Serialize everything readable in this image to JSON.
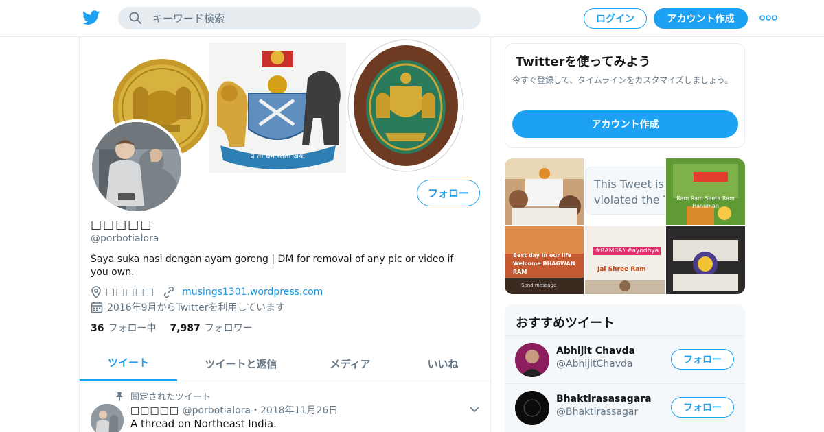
{
  "header": {
    "search_placeholder": "キーワード検索",
    "login_label": "ログイン",
    "signup_label": "アカウント作成"
  },
  "banner": {
    "emblem_text": "प्र तो धर्म स्ततो जयः"
  },
  "profile": {
    "display_name": "□□□□□",
    "handle": "@porbotialora",
    "follow_label": "フォロー",
    "bio": "Saya suka nasi dengan ayam goreng | DM for removal of any pic or video if you own.",
    "location": "□□□□□",
    "website": "musings1301.wordpress.com",
    "joined": "2016年9月からTwitterを利用しています",
    "following_count": "36",
    "following_label": "フォロー中",
    "followers_count": "7,987",
    "followers_label": "フォロワー"
  },
  "tabs": [
    {
      "label": "ツイート",
      "active": true
    },
    {
      "label": "ツイートと返信",
      "active": false
    },
    {
      "label": "メディア",
      "active": false
    },
    {
      "label": "いいね",
      "active": false
    }
  ],
  "pinned_tweet": {
    "pinned_label": "固定されたツイート",
    "author_name": "□□□□□",
    "author_handle": "@porbotialora",
    "date": "・2018年11月26日",
    "text": "A thread on Northeast India."
  },
  "signup_card": {
    "title": "Twitterを使ってみよう",
    "description": "今すぐ登録して、タイムラインをカスタマイズしましょう。",
    "button_label": "アカウント作成"
  },
  "media": {
    "violation_text_line1": "This Tweet is",
    "violation_text_line2": "violated the T",
    "thumb3_text_line1": "Ram Ram Seeta Ram",
    "thumb3_text_line2": "Hanuman",
    "thumb4_text_line1": "Best day in our life",
    "thumb4_text_line2": "Welcome BHAGWAN",
    "thumb4_text_line3": "RAM",
    "thumb4_send": "Send message",
    "thumb5_tag1": "#RAMRAM",
    "thumb5_tag2": "#ayodhya",
    "thumb5_text": "Jai Shree Ram"
  },
  "recommended": {
    "title": "おすすめツイート",
    "items": [
      {
        "name": "Abhijit Chavda",
        "handle": "@AbhijitChavda",
        "button": "フォロー"
      },
      {
        "name": "Bhaktirasasagara",
        "handle": "@Bhaktirassagar",
        "button": "フォロー"
      }
    ]
  },
  "colors": {
    "accent": "#1da1f2",
    "link": "#1b95e0",
    "muted": "#657786",
    "border": "#e6ecf0"
  },
  "icons": [
    "twitter-bird-icon",
    "search-icon",
    "more-dots-icon",
    "location-icon",
    "link-icon",
    "calendar-icon",
    "pin-icon",
    "chevron-down-icon"
  ]
}
